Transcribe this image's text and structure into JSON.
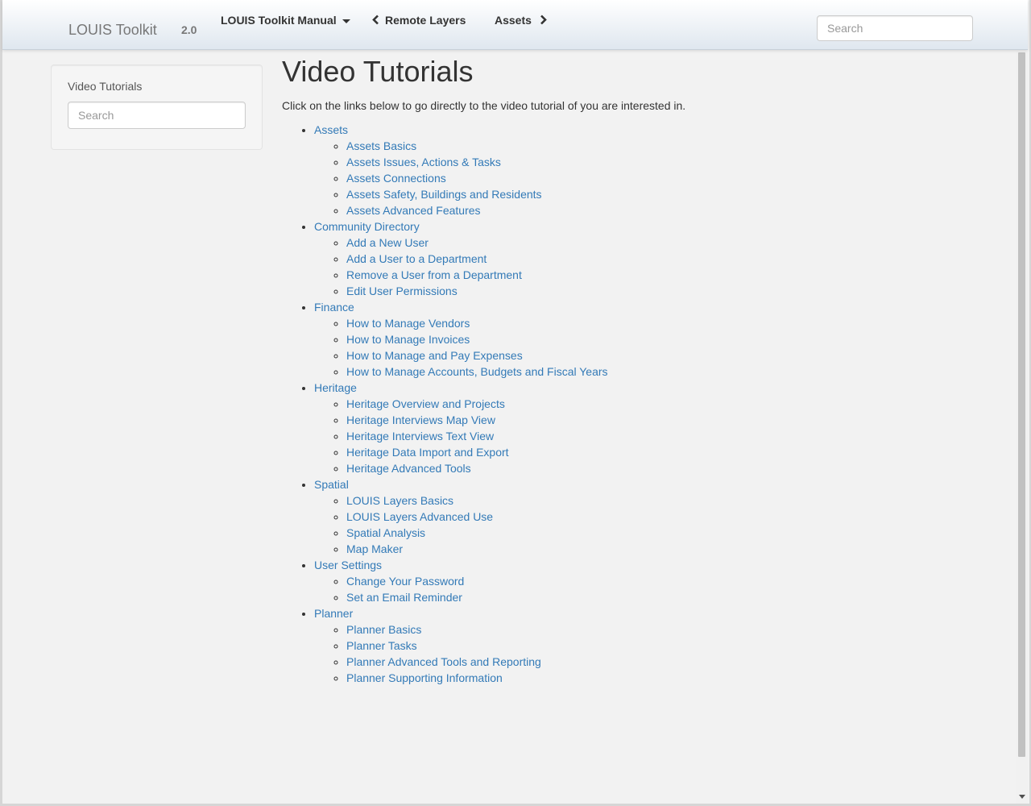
{
  "navbar": {
    "brand": "LOUIS Toolkit",
    "version": "2.0",
    "manual_label": "LOUIS Toolkit Manual",
    "prev_label": "Remote Layers",
    "next_label": "Assets",
    "search_placeholder": "Search"
  },
  "sidebar": {
    "title": "Video Tutorials",
    "search_placeholder": "Search"
  },
  "main": {
    "title": "Video Tutorials",
    "intro": "Click on the links below to go directly to the video tutorial of you are interested in.",
    "sections": [
      {
        "label": "Assets",
        "items": [
          "Assets Basics",
          "Assets Issues, Actions & Tasks",
          "Assets Connections",
          "Assets Safety, Buildings and Residents",
          "Assets Advanced Features"
        ]
      },
      {
        "label": "Community Directory",
        "items": [
          "Add a New User",
          "Add a User to a Department",
          "Remove a User from a Department",
          "Edit User Permissions"
        ]
      },
      {
        "label": "Finance",
        "items": [
          "How to Manage Vendors",
          "How to Manage Invoices",
          "How to Manage and Pay Expenses",
          "How to Manage Accounts, Budgets and Fiscal Years"
        ]
      },
      {
        "label": "Heritage",
        "items": [
          "Heritage Overview and Projects",
          "Heritage Interviews Map View",
          "Heritage Interviews Text View",
          "Heritage Data Import and Export",
          "Heritage Advanced Tools"
        ]
      },
      {
        "label": "Spatial",
        "items": [
          "LOUIS Layers Basics",
          "LOUIS Layers Advanced Use",
          "Spatial Analysis",
          "Map Maker"
        ]
      },
      {
        "label": "User Settings",
        "items": [
          "Change Your Password",
          "Set an Email Reminder"
        ]
      },
      {
        "label": "Planner",
        "items": [
          "Planner Basics",
          "Planner Tasks",
          "Planner Advanced Tools and Reporting",
          "Planner Supporting Information"
        ]
      }
    ]
  },
  "icons": {
    "prev": "chevron-left-icon",
    "next": "chevron-right-icon",
    "dropdown": "caret-down-icon"
  },
  "colors": {
    "link": "#337ab7",
    "text": "#333333",
    "background": "#f2f2f2"
  }
}
